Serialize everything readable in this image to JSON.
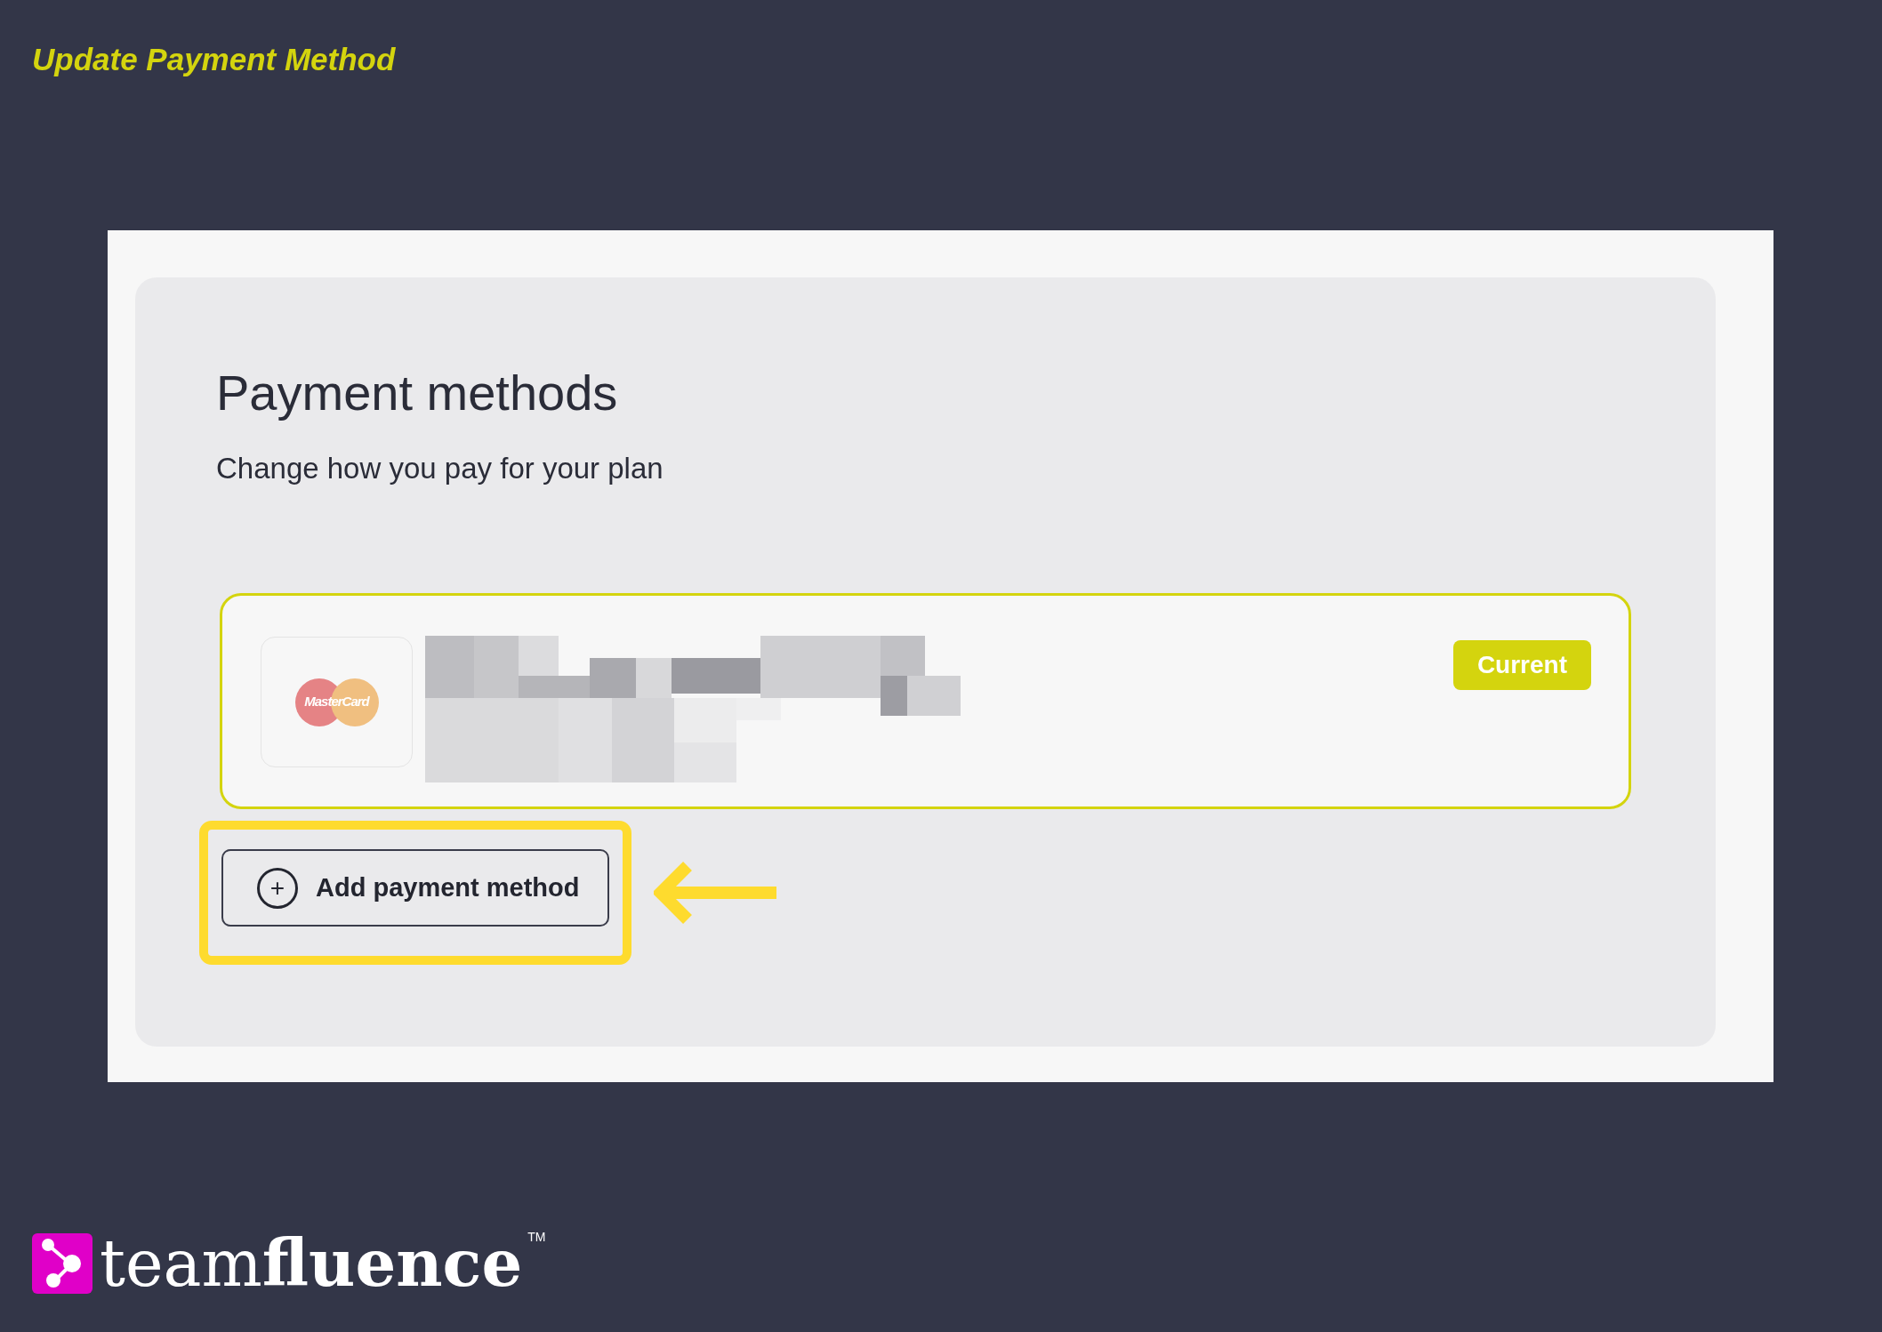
{
  "title": "Update Payment Method",
  "screen": {
    "heading": "Payment methods",
    "subtitle": "Change how you pay for your plan",
    "methods": [
      {
        "brand": "MasterCard",
        "badge": "Current",
        "selected": true
      }
    ],
    "add_button": {
      "label": "Add payment method",
      "icon": "+"
    }
  },
  "logo": {
    "wordmark": "team**fluence**",
    "trademark": "TM"
  }
}
